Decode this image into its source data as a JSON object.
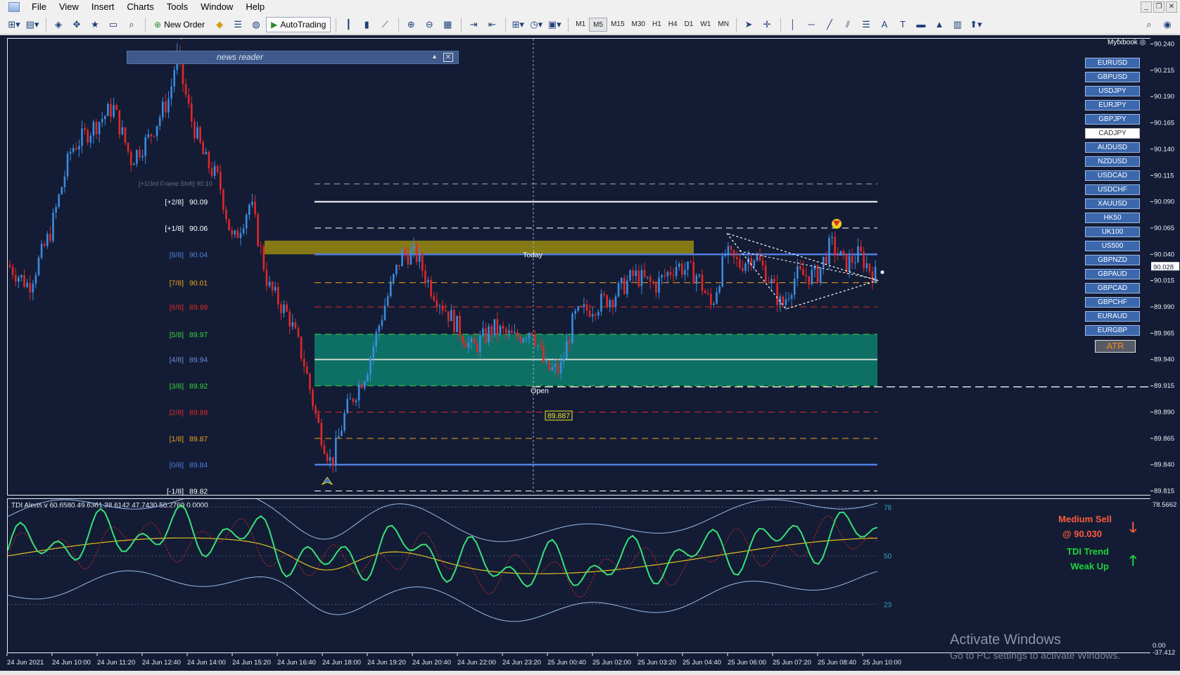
{
  "menu": [
    "File",
    "View",
    "Insert",
    "Charts",
    "Tools",
    "Window",
    "Help"
  ],
  "toolbar": {
    "new_order": "New Order",
    "autotrading": "AutoTrading",
    "timeframes": [
      "M1",
      "M5",
      "M15",
      "M30",
      "H1",
      "H4",
      "D1",
      "W1",
      "MN"
    ],
    "active_timeframe": "M5"
  },
  "news_reader": {
    "title": "news reader"
  },
  "myfxbook": "Myfxbook",
  "symbols": [
    "EURUSD",
    "GBPUSD",
    "USDJPY",
    "EURJPY",
    "GBPJPY",
    "CADJPY",
    "AUDUSD",
    "NZDUSD",
    "USDCAD",
    "USDCHF",
    "XAUUSD",
    "HK50",
    "UK100",
    "US500",
    "GBPNZD",
    "GBPAUD",
    "GBPCAD",
    "GBPCHF",
    "EURAUD",
    "EURGBP"
  ],
  "selected_symbol": "CADJPY",
  "atr_button": "ATR",
  "murrey_levels": [
    {
      "label": "[+2/8]",
      "value": "90.09",
      "color": "#ffffff"
    },
    {
      "label": "[+1/8]",
      "value": "90.06",
      "color": "#ffffff"
    },
    {
      "label": "[8/8]",
      "value": "90.04",
      "color": "#4f7fe0"
    },
    {
      "label": "[7/8]",
      "value": "90.01",
      "color": "#f0a020"
    },
    {
      "label": "[6/8]",
      "value": "89.99",
      "color": "#e02828"
    },
    {
      "label": "[5/8]",
      "value": "89.97",
      "color": "#3cd23c"
    },
    {
      "label": "[4/8]",
      "value": "89.94",
      "color": "#6a8fd8"
    },
    {
      "label": "[3/8]",
      "value": "89.92",
      "color": "#3cd23c"
    },
    {
      "label": "[2/8]",
      "value": "89.89",
      "color": "#e02828"
    },
    {
      "label": "[1/8]",
      "value": "89.87",
      "color": "#f0a020"
    },
    {
      "label": "[0/8]",
      "value": "89.84",
      "color": "#4f7fe0"
    },
    {
      "label": "[-1/8]",
      "value": "89.82",
      "color": "#ffffff"
    }
  ],
  "frame_shift_label": "[+1/3rd Frame Shift] 90.10",
  "today_label": "Today",
  "open_label": "Open",
  "open_price_label": "89.887",
  "price_axis": [
    "90.240",
    "90.215",
    "90.190",
    "90.165",
    "90.140",
    "90.115",
    "90.090",
    "90.065",
    "90.040",
    "90.015",
    "89.990",
    "89.965",
    "89.940",
    "89.915",
    "89.890",
    "89.865",
    "89.840",
    "89.815"
  ],
  "current_price": "90.028",
  "indicator": {
    "title": "TDI Alerts v 60.6580 49.6361 38.6142 47.7430 50.2769 0.0000",
    "levels": [
      "78",
      "50",
      "23"
    ],
    "axis_top": "78.5662",
    "axis_bottom": "0.00",
    "axis_bottom2": "-37.412"
  },
  "signals": {
    "line1": "Medium Sell",
    "line2": "@ 90.030",
    "line3": "TDI Trend",
    "line4": "Weak Up",
    "sell_color": "#ff5a3c",
    "trend_color": "#1fd23a"
  },
  "time_axis": [
    "24 Jun 2021",
    "24 Jun 10:00",
    "24 Jun 11:20",
    "24 Jun 12:40",
    "24 Jun 14:00",
    "24 Jun 15:20",
    "24 Jun 16:40",
    "24 Jun 18:00",
    "24 Jun 19:20",
    "24 Jun 20:40",
    "24 Jun 22:00",
    "24 Jun 23:20",
    "25 Jun 00:40",
    "25 Jun 02:00",
    "25 Jun 03:20",
    "25 Jun 04:40",
    "25 Jun 06:00",
    "25 Jun 07:20",
    "25 Jun 08:40",
    "25 Jun 10:00"
  ],
  "watermark": {
    "line1": "Activate Windows",
    "line2": "Go to PC settings to activate Windows."
  },
  "colors": {
    "background": "#131c34",
    "bull": "#3b8be0",
    "bear": "#e02828",
    "supply_zone": "#9a8a10",
    "demand_zone": "#0e7a6a",
    "tdi_rsi": "#39e07a",
    "tdi_signal": "#e0c020",
    "tdi_band": "#9ab8e8"
  }
}
